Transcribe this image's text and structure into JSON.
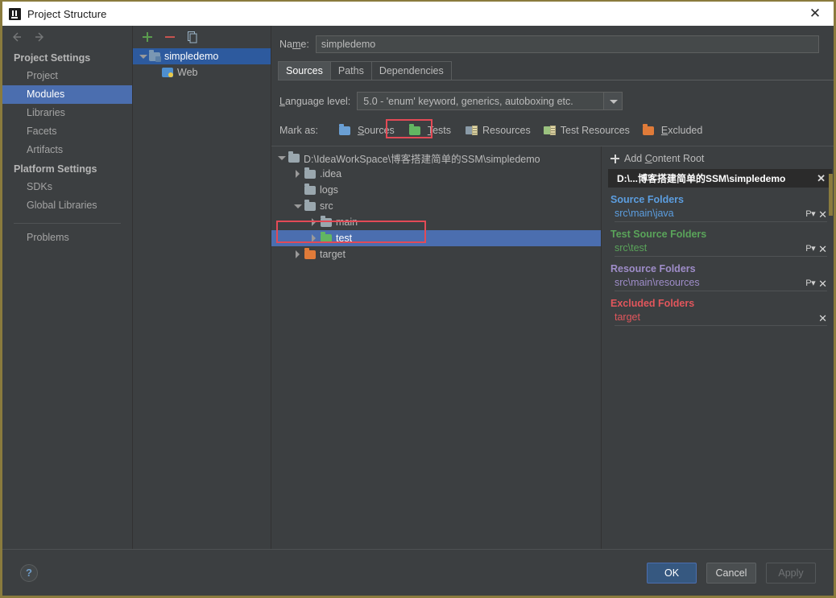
{
  "window": {
    "title": "Project Structure",
    "logo_icon": "intellij-idea-logo",
    "close_icon": "close-icon"
  },
  "sidebar": {
    "back_icon": "arrow-left-icon",
    "forward_icon": "arrow-right-icon",
    "sections": [
      {
        "title": "Project Settings",
        "items": [
          {
            "label": "Project",
            "selected": false
          },
          {
            "label": "Modules",
            "selected": true
          },
          {
            "label": "Libraries",
            "selected": false
          },
          {
            "label": "Facets",
            "selected": false
          },
          {
            "label": "Artifacts",
            "selected": false
          }
        ]
      },
      {
        "title": "Platform Settings",
        "items": [
          {
            "label": "SDKs",
            "selected": false
          },
          {
            "label": "Global Libraries",
            "selected": false
          }
        ]
      }
    ],
    "extra": {
      "label": "Problems"
    }
  },
  "modules_panel": {
    "toolbar": {
      "add_icon": "plus-icon",
      "remove_icon": "minus-icon",
      "copy_icon": "copy-icon"
    },
    "tree": [
      {
        "label": "simpledemo",
        "icon": "module-folder-icon",
        "indent": 0,
        "expander": "down",
        "selected": true
      },
      {
        "label": "Web",
        "icon": "web-facet-icon",
        "indent": 1,
        "expander": "none",
        "selected": false
      }
    ]
  },
  "main": {
    "name_label": "Name:",
    "name_value": "simpledemo",
    "tabs": [
      {
        "label": "Sources",
        "active": true
      },
      {
        "label": "Paths",
        "active": false
      },
      {
        "label": "Dependencies",
        "active": false
      }
    ],
    "language_level_label": "Language level:",
    "language_level_value": "5.0 - 'enum' keyword, generics, autoboxing etc.",
    "dropdown_icon": "chevron-down-icon",
    "mark_as_label": "Mark as:",
    "mark_as_buttons": [
      {
        "label": "Sources",
        "icon": "folder-blue-icon",
        "highlighted": false
      },
      {
        "label": "Tests",
        "icon": "folder-green-icon",
        "highlighted": true
      },
      {
        "label": "Resources",
        "icon": "resources-folder-icon",
        "highlighted": false
      },
      {
        "label": "Test Resources",
        "icon": "test-resources-folder-icon",
        "highlighted": false
      },
      {
        "label": "Excluded",
        "icon": "folder-orange-icon",
        "highlighted": false
      }
    ]
  },
  "content_tree": [
    {
      "label": "D:\\IdeaWorkSpace\\博客搭建简单的SSM\\simpledemo",
      "icon": "folder-gray-icon",
      "indent": 0,
      "expander": "down",
      "selected": false
    },
    {
      "label": ".idea",
      "icon": "folder-gray-icon",
      "indent": 1,
      "expander": "right",
      "selected": false
    },
    {
      "label": "logs",
      "icon": "folder-gray-icon",
      "indent": 1,
      "expander": "none",
      "selected": false
    },
    {
      "label": "src",
      "icon": "folder-gray-icon",
      "indent": 1,
      "expander": "down",
      "selected": false
    },
    {
      "label": "main",
      "icon": "folder-gray-icon",
      "indent": 2,
      "expander": "right",
      "selected": false
    },
    {
      "label": "test",
      "icon": "folder-green-icon",
      "indent": 2,
      "expander": "right",
      "selected": true
    },
    {
      "label": "target",
      "icon": "folder-orange-icon",
      "indent": 1,
      "expander": "right",
      "selected": false
    }
  ],
  "detail_panel": {
    "add_content_root": "Add Content Root",
    "add_icon": "plus-icon",
    "root_path": "D:\\...博客搭建简单的SSM\\simpledemo",
    "root_remove_icon": "close-icon",
    "groups": [
      {
        "title": "Source Folders",
        "kind": "src",
        "color": "#5c9ee0",
        "items": [
          {
            "path": "src\\main\\java",
            "package_prefix_icon": "package-prefix-icon",
            "remove_icon": "close-icon",
            "has_prefix": true
          }
        ]
      },
      {
        "title": "Test Source Folders",
        "kind": "test",
        "color": "#5aa45a",
        "items": [
          {
            "path": "src\\test",
            "package_prefix_icon": "package-prefix-icon",
            "remove_icon": "close-icon",
            "has_prefix": true
          }
        ]
      },
      {
        "title": "Resource Folders",
        "kind": "res",
        "color": "#9f8dc9",
        "items": [
          {
            "path": "src\\main\\resources",
            "package_prefix_icon": "package-prefix-icon",
            "remove_icon": "close-icon",
            "has_prefix": true
          }
        ]
      },
      {
        "title": "Excluded Folders",
        "kind": "exc",
        "color": "#e2565c",
        "items": [
          {
            "path": "target",
            "package_prefix_icon": "",
            "remove_icon": "close-icon",
            "has_prefix": false
          }
        ]
      }
    ]
  },
  "footer": {
    "help_icon": "help-question-icon",
    "ok_label": "OK",
    "cancel_label": "Cancel",
    "apply_label": "Apply"
  },
  "annotations": {
    "tests_button_box_color": "#e34a56",
    "test_row_box_color": "#e34a56"
  }
}
